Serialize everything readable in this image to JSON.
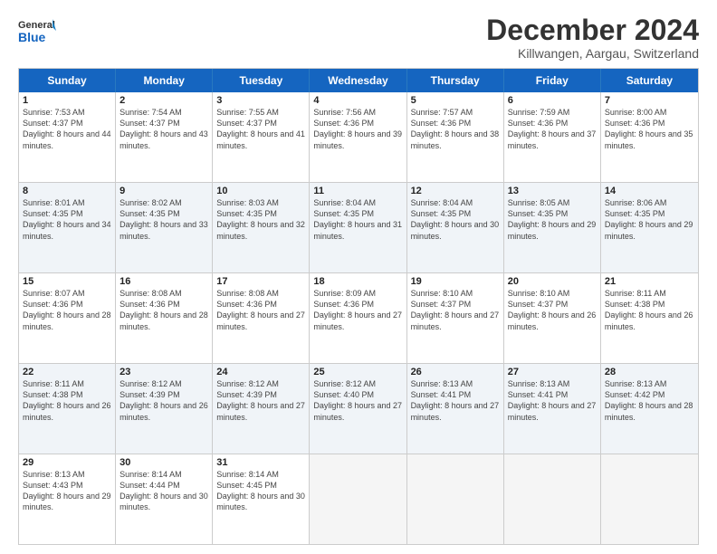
{
  "header": {
    "logo_line1": "General",
    "logo_line2": "Blue",
    "title": "December 2024",
    "subtitle": "Killwangen, Aargau, Switzerland"
  },
  "weekdays": [
    "Sunday",
    "Monday",
    "Tuesday",
    "Wednesday",
    "Thursday",
    "Friday",
    "Saturday"
  ],
  "weeks": [
    [
      {
        "day": 1,
        "rise": "7:53 AM",
        "set": "4:37 PM",
        "daylight": "8 hours and 44 minutes."
      },
      {
        "day": 2,
        "rise": "7:54 AM",
        "set": "4:37 PM",
        "daylight": "8 hours and 43 minutes."
      },
      {
        "day": 3,
        "rise": "7:55 AM",
        "set": "4:37 PM",
        "daylight": "8 hours and 41 minutes."
      },
      {
        "day": 4,
        "rise": "7:56 AM",
        "set": "4:36 PM",
        "daylight": "8 hours and 39 minutes."
      },
      {
        "day": 5,
        "rise": "7:57 AM",
        "set": "4:36 PM",
        "daylight": "8 hours and 38 minutes."
      },
      {
        "day": 6,
        "rise": "7:59 AM",
        "set": "4:36 PM",
        "daylight": "8 hours and 37 minutes."
      },
      {
        "day": 7,
        "rise": "8:00 AM",
        "set": "4:36 PM",
        "daylight": "8 hours and 35 minutes."
      }
    ],
    [
      {
        "day": 8,
        "rise": "8:01 AM",
        "set": "4:35 PM",
        "daylight": "8 hours and 34 minutes."
      },
      {
        "day": 9,
        "rise": "8:02 AM",
        "set": "4:35 PM",
        "daylight": "8 hours and 33 minutes."
      },
      {
        "day": 10,
        "rise": "8:03 AM",
        "set": "4:35 PM",
        "daylight": "8 hours and 32 minutes."
      },
      {
        "day": 11,
        "rise": "8:04 AM",
        "set": "4:35 PM",
        "daylight": "8 hours and 31 minutes."
      },
      {
        "day": 12,
        "rise": "8:04 AM",
        "set": "4:35 PM",
        "daylight": "8 hours and 30 minutes."
      },
      {
        "day": 13,
        "rise": "8:05 AM",
        "set": "4:35 PM",
        "daylight": "8 hours and 29 minutes."
      },
      {
        "day": 14,
        "rise": "8:06 AM",
        "set": "4:35 PM",
        "daylight": "8 hours and 29 minutes."
      }
    ],
    [
      {
        "day": 15,
        "rise": "8:07 AM",
        "set": "4:36 PM",
        "daylight": "8 hours and 28 minutes."
      },
      {
        "day": 16,
        "rise": "8:08 AM",
        "set": "4:36 PM",
        "daylight": "8 hours and 28 minutes."
      },
      {
        "day": 17,
        "rise": "8:08 AM",
        "set": "4:36 PM",
        "daylight": "8 hours and 27 minutes."
      },
      {
        "day": 18,
        "rise": "8:09 AM",
        "set": "4:36 PM",
        "daylight": "8 hours and 27 minutes."
      },
      {
        "day": 19,
        "rise": "8:10 AM",
        "set": "4:37 PM",
        "daylight": "8 hours and 27 minutes."
      },
      {
        "day": 20,
        "rise": "8:10 AM",
        "set": "4:37 PM",
        "daylight": "8 hours and 26 minutes."
      },
      {
        "day": 21,
        "rise": "8:11 AM",
        "set": "4:38 PM",
        "daylight": "8 hours and 26 minutes."
      }
    ],
    [
      {
        "day": 22,
        "rise": "8:11 AM",
        "set": "4:38 PM",
        "daylight": "8 hours and 26 minutes."
      },
      {
        "day": 23,
        "rise": "8:12 AM",
        "set": "4:39 PM",
        "daylight": "8 hours and 26 minutes."
      },
      {
        "day": 24,
        "rise": "8:12 AM",
        "set": "4:39 PM",
        "daylight": "8 hours and 27 minutes."
      },
      {
        "day": 25,
        "rise": "8:12 AM",
        "set": "4:40 PM",
        "daylight": "8 hours and 27 minutes."
      },
      {
        "day": 26,
        "rise": "8:13 AM",
        "set": "4:41 PM",
        "daylight": "8 hours and 27 minutes."
      },
      {
        "day": 27,
        "rise": "8:13 AM",
        "set": "4:41 PM",
        "daylight": "8 hours and 27 minutes."
      },
      {
        "day": 28,
        "rise": "8:13 AM",
        "set": "4:42 PM",
        "daylight": "8 hours and 28 minutes."
      }
    ],
    [
      {
        "day": 29,
        "rise": "8:13 AM",
        "set": "4:43 PM",
        "daylight": "8 hours and 29 minutes."
      },
      {
        "day": 30,
        "rise": "8:14 AM",
        "set": "4:44 PM",
        "daylight": "8 hours and 30 minutes."
      },
      {
        "day": 31,
        "rise": "8:14 AM",
        "set": "4:45 PM",
        "daylight": "8 hours and 30 minutes."
      },
      null,
      null,
      null,
      null
    ]
  ],
  "colors": {
    "header_bg": "#1565c0",
    "header_text": "#ffffff",
    "even_row_bg": "#f9f9f9",
    "empty_bg": "#f5f5f5"
  }
}
